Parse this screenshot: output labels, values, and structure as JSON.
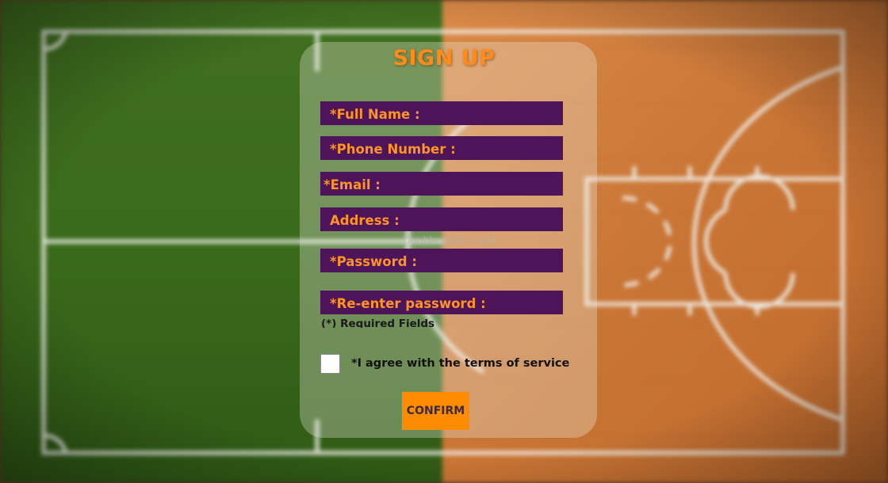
{
  "form": {
    "title": "SIGN UP",
    "fields": [
      {
        "label": "*Full Name :"
      },
      {
        "label": "*Phone Number :"
      },
      {
        "label": "*Email :"
      },
      {
        "label": "Address :"
      },
      {
        "label": "*Password :"
      },
      {
        "label": "*Re-enter password :"
      }
    ],
    "required_note": "(*) Required Fields",
    "terms_label": "*I agree with the terms of service",
    "terms_checked": false,
    "confirm_label": "CONFIRM"
  },
  "editor_hint": "Double click to edit",
  "colors": {
    "title": "#ff8c1a",
    "field_background": "#4d145a",
    "field_label": "#ff9426",
    "button_background": "#ff8c00",
    "grass": "#3d6e1e",
    "wood": "#c8773a",
    "court_lines": "#f2f2ee"
  }
}
